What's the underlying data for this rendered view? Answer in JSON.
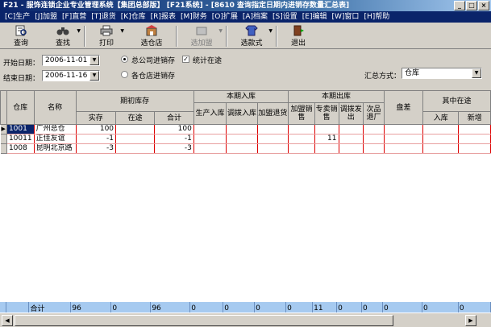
{
  "window": {
    "title": "F21 - 服饰连锁企业专业管理系统【集团总部版】 [F21系统] - [8610 查询指定日期内进销存数量汇总表]",
    "controls": [
      "_",
      "□",
      "×"
    ]
  },
  "menu": [
    "[C]生产",
    "[J]加盟",
    "[F]直营",
    "[T]退货",
    "[K]仓库",
    "[R]报表",
    "[M]财务",
    "[O]扩展",
    "[A]档案",
    "[S]设置",
    "[E]编辑",
    "[W]窗口",
    "[H]帮助"
  ],
  "toolbar": {
    "query": "查询",
    "find": "查找",
    "print": "打印",
    "select_store": "选仓店",
    "select_franchise": "选加盟",
    "select_style": "选款式",
    "exit": "退出"
  },
  "filters": {
    "start_label": "开始日期：",
    "start_value": "2006-11-01",
    "end_label": "结束日期：",
    "end_value": "2006-11-16",
    "radio_company": "总公司进销存",
    "radio_store": "各仓店进销存",
    "check_transit": "统计在途",
    "summary_label": "汇总方式：",
    "summary_value": "仓库"
  },
  "grid": {
    "headers": {
      "warehouse": "仓库",
      "name": "名称",
      "opening": "期初库存",
      "actual": "实存",
      "transit": "在途",
      "total": "合计",
      "inbound": "本期入库",
      "prod_in": "生产入库",
      "transfer_in": "调拨入库",
      "franchise_return": "加盟退货",
      "outbound": "本期出库",
      "franchise_sale": "加盟销售",
      "store_sale": "专卖销售",
      "transfer_out": "调拨发出",
      "defect_return": "次品退厂",
      "stocktake": "盘差",
      "in_transit": "其中在途",
      "transit_in": "入库",
      "transit_new": "新增"
    },
    "rows": [
      {
        "code": "1001",
        "name": "广州总仓",
        "actual": "100",
        "transit": "",
        "total": "100",
        "store_sale": ""
      },
      {
        "code": "10011",
        "name": "正佳友谊",
        "actual": "-1",
        "transit": "",
        "total": "-1",
        "store_sale": "11"
      },
      {
        "code": "1008",
        "name": "昆明北京路",
        "actual": "-3",
        "transit": "",
        "total": "-3",
        "store_sale": ""
      }
    ],
    "totals": {
      "label": "合计",
      "actual": "96",
      "transit": "0",
      "total": "96",
      "prod_in": "0",
      "transfer_in": "0",
      "franchise_return": "0",
      "franchise_sale": "0",
      "store_sale": "11",
      "transfer_out": "0",
      "defect_return": "0",
      "stocktake": "0",
      "transit_in": "0",
      "transit_new": "0"
    }
  }
}
